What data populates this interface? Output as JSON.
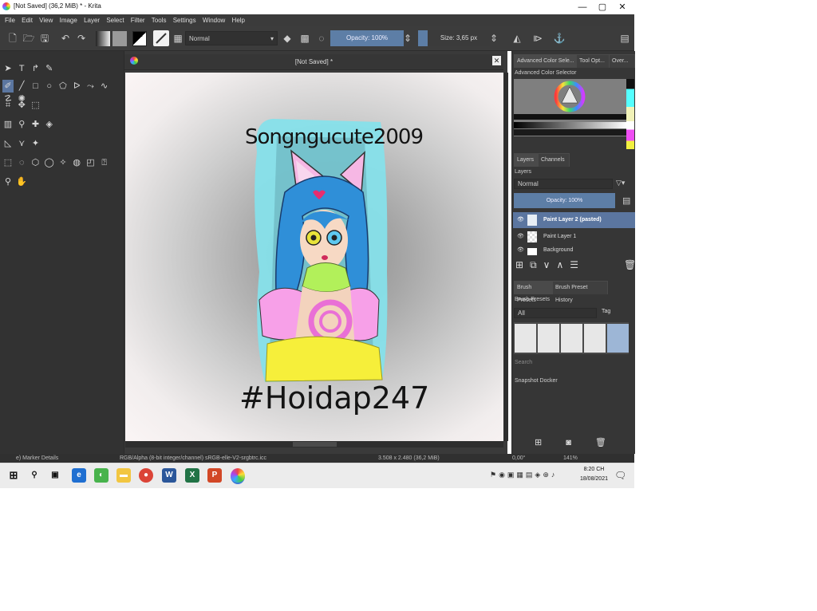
{
  "window": {
    "title": "[Not Saved]  (36,2 MiB)  * - Krita",
    "min": "—",
    "max": "▢",
    "close": "✕"
  },
  "menu": [
    "File",
    "Edit",
    "View",
    "Image",
    "Layer",
    "Select",
    "Filter",
    "Tools",
    "Settings",
    "Window",
    "Help"
  ],
  "toolbar": {
    "blend_mode": "Normal",
    "opacity": "Opacity: 100%",
    "size": "Size: 3,65 px"
  },
  "document": {
    "tab_title": "[Not Saved]  *",
    "canvas_text_top": "Songngucute2009",
    "canvas_text_bottom": "#Hoidap247"
  },
  "dockers": {
    "tabs": [
      "Advanced Color Sele...",
      "Tool Opt...",
      "Over..."
    ],
    "color_title": "Advanced Color Selector",
    "layer_tabs": [
      "Layers",
      "Channels"
    ],
    "layers_title": "Layers",
    "layer_blend": "Normal",
    "layer_opacity": "Opacity:  100%",
    "layers": [
      {
        "name": "Paint Layer 2 (pasted)",
        "selected": true
      },
      {
        "name": "Paint Layer 1",
        "selected": false
      },
      {
        "name": "Background",
        "selected": false
      }
    ],
    "brush_tabs": [
      "Brush Presets",
      "Brush Preset History"
    ],
    "brush_title": "Brush Presets",
    "brush_filter": "All",
    "brush_tag": "Tag",
    "brush_search": "Search",
    "snapshot_title": "Snapshot Docker"
  },
  "status": {
    "brush": "e) Marker Details",
    "colorspace": "RGB/Alpha (8-bit integer/channel)  sRGB-elle-V2-srgbtrc.icc",
    "dimensions": "3.508 x 2.480 (36,2 MiB)",
    "rotation": "0,00°",
    "zoom": "141%"
  },
  "taskbar": {
    "time": "8:20 CH",
    "date": "18/08/2021"
  },
  "colors": {
    "accent": "#5b76a0",
    "bg_dark": "#363636",
    "cyan_fur": "#7fe3ec",
    "hair_blue": "#2f8fd8",
    "pink": "#f7a0e8",
    "yellow": "#f6ef3a"
  }
}
